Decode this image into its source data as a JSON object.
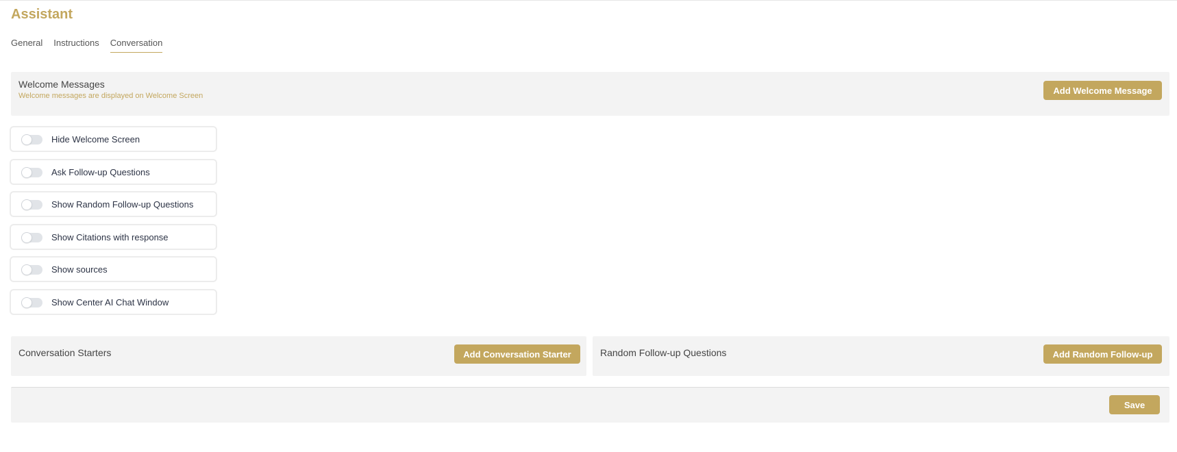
{
  "page": {
    "title": "Assistant"
  },
  "tabs": [
    {
      "label": "General",
      "active": false
    },
    {
      "label": "Instructions",
      "active": false
    },
    {
      "label": "Conversation",
      "active": true
    }
  ],
  "welcome": {
    "title": "Welcome Messages",
    "subtitle": "Welcome messages are displayed on Welcome Screen",
    "add_button": "Add Welcome Message"
  },
  "toggles": [
    {
      "label": "Hide Welcome Screen",
      "checked": false
    },
    {
      "label": "Ask Follow-up Questions",
      "checked": false
    },
    {
      "label": "Show Random Follow-up Questions",
      "checked": false
    },
    {
      "label": "Show Citations with response",
      "checked": false
    },
    {
      "label": "Show sources",
      "checked": false
    },
    {
      "label": "Show Center AI Chat Window",
      "checked": false
    }
  ],
  "starters": {
    "title": "Conversation Starters",
    "add_button": "Add Conversation Starter"
  },
  "followups": {
    "title": "Random Follow-up Questions",
    "add_button": "Add Random Follow-up"
  },
  "footer": {
    "save_button": "Save"
  },
  "colors": {
    "accent": "#c3a75e",
    "panel_bg": "#f3f3f3",
    "toggle_off": "#e1e4e8"
  }
}
